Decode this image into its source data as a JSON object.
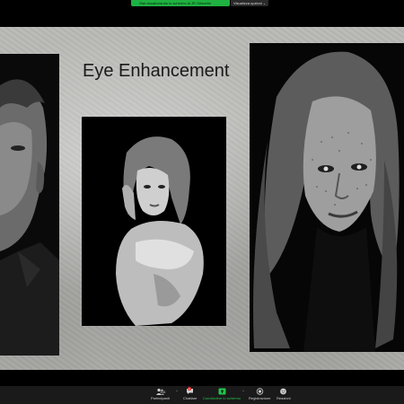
{
  "share_bar": {
    "banner_text": "Stai visualizzando lo schermo di JR Gilmartin",
    "view_options_label": "Visualizza opzioni ⌄"
  },
  "slide": {
    "title": "Eye Enhancement"
  },
  "toolbar": {
    "participants_label": "Partecipanti",
    "participants_count": "116",
    "chat_label": "Chattare",
    "chat_badge": "2",
    "share_label": "Condividere lo schermo",
    "record_label": "Registrazione",
    "reactions_label": "Reazioni"
  },
  "colors": {
    "share_green": "#1fb141",
    "toolbar_bg": "#1a1a1a",
    "slide_bg": "#b9b9b6"
  }
}
